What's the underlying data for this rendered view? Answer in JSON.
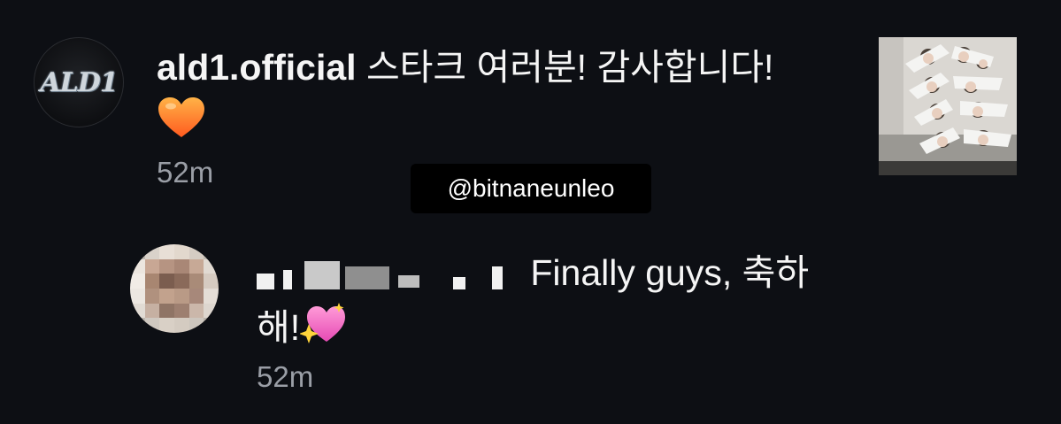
{
  "post": {
    "username": "ald1.official",
    "avatar_logo": "ALD1",
    "text": " 스타크 여러분! 감사합니다! ",
    "emoji": "orange-heart",
    "time": "52m"
  },
  "watermark": "@bitnaneunleo",
  "reply": {
    "text": " Finally guys, 축하해!",
    "emoji": "sparkling-heart",
    "time": "52m"
  }
}
